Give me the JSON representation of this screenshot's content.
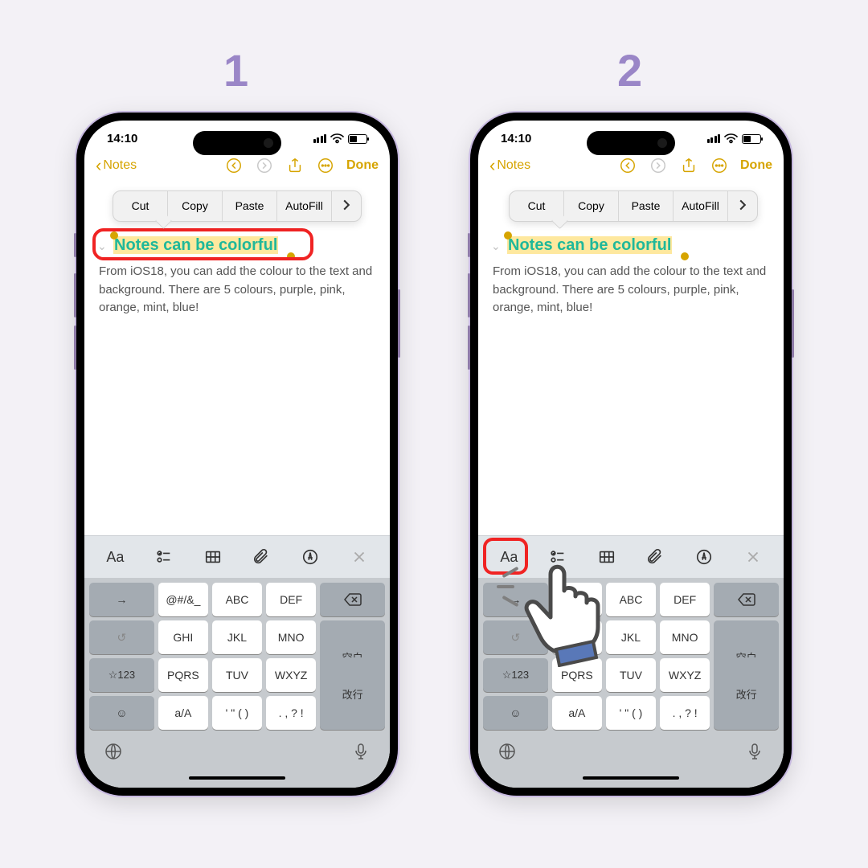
{
  "steps": {
    "label1": "1",
    "label2": "2"
  },
  "status_bar": {
    "time": "14:10"
  },
  "nav": {
    "back": "Notes",
    "done": "Done"
  },
  "popover": {
    "items": [
      "Cut",
      "Copy",
      "Paste",
      "AutoFill"
    ]
  },
  "note": {
    "title": "Notes can be colorful",
    "body": "From iOS18, you can add the colour to the text and background. There are 5 colours, purple, pink, orange, mint, blue!"
  },
  "format_bar": {
    "aa": "Aa"
  },
  "keyboard": {
    "row1": [
      "→",
      "@#/&_",
      "ABC",
      "DEF",
      "⌫"
    ],
    "row2": [
      "↺",
      "GHI",
      "JKL",
      "MNO",
      "空白"
    ],
    "row3": [
      "☆123",
      "PQRS",
      "TUV",
      "WXYZ",
      "改行"
    ],
    "row4": [
      "☺",
      "a/A",
      "' \" ( )",
      ". , ? !"
    ]
  }
}
